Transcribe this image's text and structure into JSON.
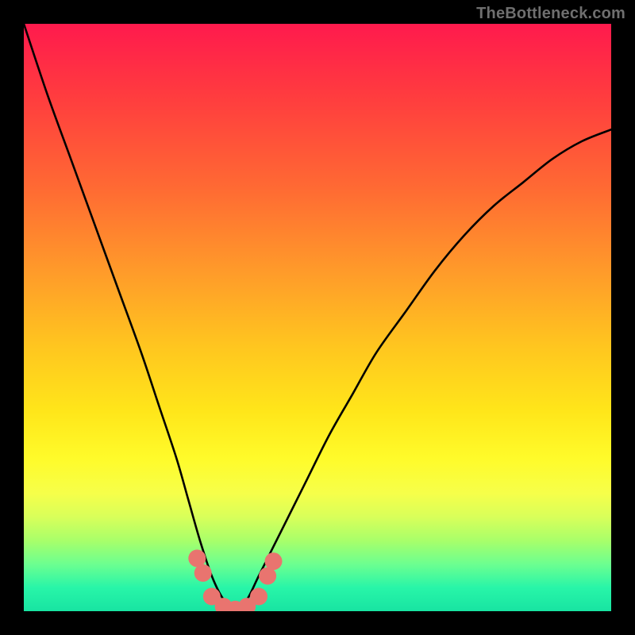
{
  "watermark": "TheBottleneck.com",
  "colors": {
    "frame": "#000000",
    "curve": "#000000",
    "marker": "#e9746f",
    "gradient_stops": [
      "#ff1a4d",
      "#ff3b3f",
      "#ff6a33",
      "#ff9a2a",
      "#ffc61f",
      "#ffe61a",
      "#fffb2a",
      "#f6ff4a",
      "#d8ff5a",
      "#a8ff6a",
      "#6cff90",
      "#28f5a8",
      "#18e4a2"
    ]
  },
  "chart_data": {
    "type": "line",
    "title": "",
    "xlabel": "",
    "ylabel": "",
    "xlim": [
      0,
      100
    ],
    "ylim": [
      0,
      100
    ],
    "grid": false,
    "legend": false,
    "series": [
      {
        "name": "bottleneck-curve",
        "x": [
          0,
          4,
          8,
          12,
          16,
          20,
          23,
          26,
          28,
          30,
          32,
          34,
          36,
          38,
          40,
          44,
          48,
          52,
          56,
          60,
          65,
          70,
          75,
          80,
          85,
          90,
          95,
          100
        ],
        "y": [
          100,
          88,
          77,
          66,
          55,
          44,
          35,
          26,
          19,
          12,
          6,
          2,
          0.3,
          2,
          6,
          14,
          22,
          30,
          37,
          44,
          51,
          58,
          64,
          69,
          73,
          77,
          80,
          82
        ]
      }
    ],
    "highlight_markers": {
      "name": "near-zero-band",
      "x": [
        29.5,
        30.5,
        32,
        34,
        36,
        38,
        40,
        41.5,
        42.5
      ],
      "y": [
        9,
        6.5,
        2.5,
        0.8,
        0.3,
        0.8,
        2.5,
        6,
        8.5
      ]
    }
  }
}
